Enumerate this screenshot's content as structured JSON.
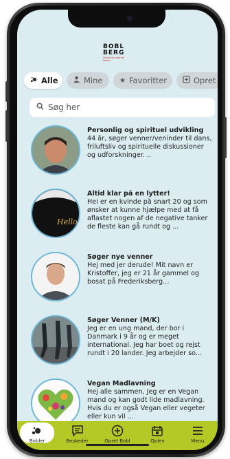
{
  "app": {
    "logo_line1": "BOBL",
    "logo_line2": "BERG",
    "logo_sub": "Danmarks største bobler"
  },
  "tabs": [
    {
      "label": "Alle",
      "icon": "bubbles-icon",
      "active": true
    },
    {
      "label": "Mine",
      "icon": "person-icon",
      "active": false
    },
    {
      "label": "Favoritter",
      "icon": "star-icon",
      "active": false
    },
    {
      "label": "Opret",
      "icon": "plus-square-icon",
      "active": false
    }
  ],
  "search": {
    "placeholder": "Søg her"
  },
  "bubbles": [
    {
      "title": "Personlig og spirituel udvikling",
      "description": "44 år, søger venner/veninder til dans, friluftsliv og spirituelle diskussioner og udforskninger. ..",
      "avatar": "man-portrait"
    },
    {
      "title": "Altid klar på en lytter!",
      "description": "Hei er en kvinde på snart 20 og som ønsker at kunne hjælpe med at få aflastet nogen af de negative tanker de fleste kan gå rundt og ...",
      "avatar": "black-shirt-hello"
    },
    {
      "title": "Søger nye venner",
      "description": "Hej med jer derude! Mit navn er Kristoffer, jeg er 21 år gammel og bosat på Frederiksberg...",
      "avatar": "young-man-portrait"
    },
    {
      "title": "Søger Venner (M/K)",
      "description": "Jeg er en ung mand, der bor i Danmark i 9 år og er meget international. Jeg har boet og rejst rundt i 20 lander. Jeg arbejder so...",
      "avatar": "people-walking"
    },
    {
      "title": "Vegan Madlavning",
      "description": "Hej alle sammen, Jeg er en Vegan mand og kan godt lide madlavning. Hvis du er også Vegan eller vegeter eller kun vil ...",
      "avatar": "vegetable-heart"
    }
  ],
  "nav": [
    {
      "label": "Bobler",
      "icon": "bubbles-icon",
      "active": true
    },
    {
      "label": "Beskeder",
      "icon": "message-icon",
      "active": false
    },
    {
      "label": "Opret Bobl",
      "icon": "plus-circle-icon",
      "active": false
    },
    {
      "label": "Oplev",
      "icon": "calendar-icon",
      "active": false
    },
    {
      "label": "Menu",
      "icon": "hamburger-icon",
      "active": false
    }
  ],
  "colors": {
    "screen_bg": "#dcedf2",
    "nav_bg": "#b5c926",
    "avatar_ring": "#6fb7d6",
    "logo_red": "#c0392b"
  }
}
